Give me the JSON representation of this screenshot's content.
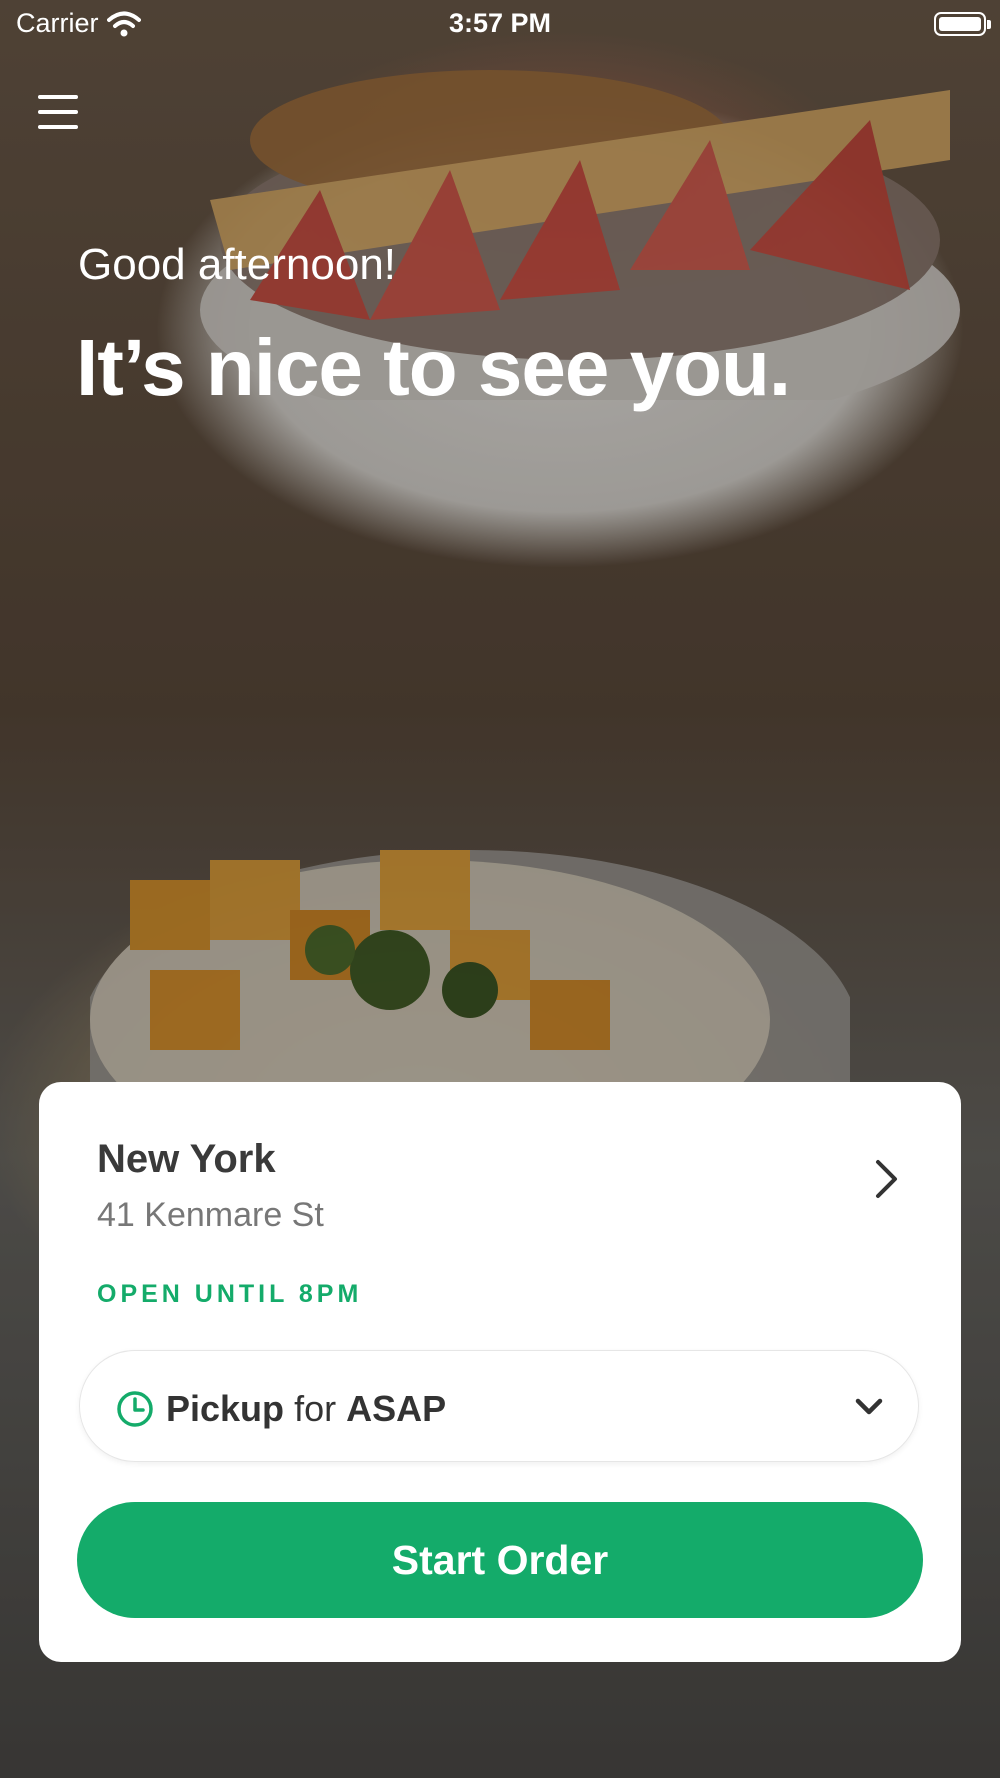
{
  "status_bar": {
    "carrier": "Carrier",
    "time": "3:57 PM"
  },
  "hero": {
    "greeting": "Good afternoon!",
    "headline": "It’s nice to see you."
  },
  "location": {
    "city": "New York",
    "address": "41 Kenmare St",
    "status": "OPEN UNTIL 8PM"
  },
  "order_mode": {
    "mode": "Pickup",
    "connector": "for",
    "time": "ASAP"
  },
  "start_button": {
    "label": "Start Order"
  },
  "colors": {
    "accent": "#14ab6a",
    "card": "#ffffff",
    "text_dark": "#3a3a3a",
    "text_muted": "#777777"
  },
  "icons": [
    "wifi-icon",
    "battery-icon",
    "menu-icon",
    "chevron-right-icon",
    "clock-icon",
    "chevron-down-icon"
  ]
}
